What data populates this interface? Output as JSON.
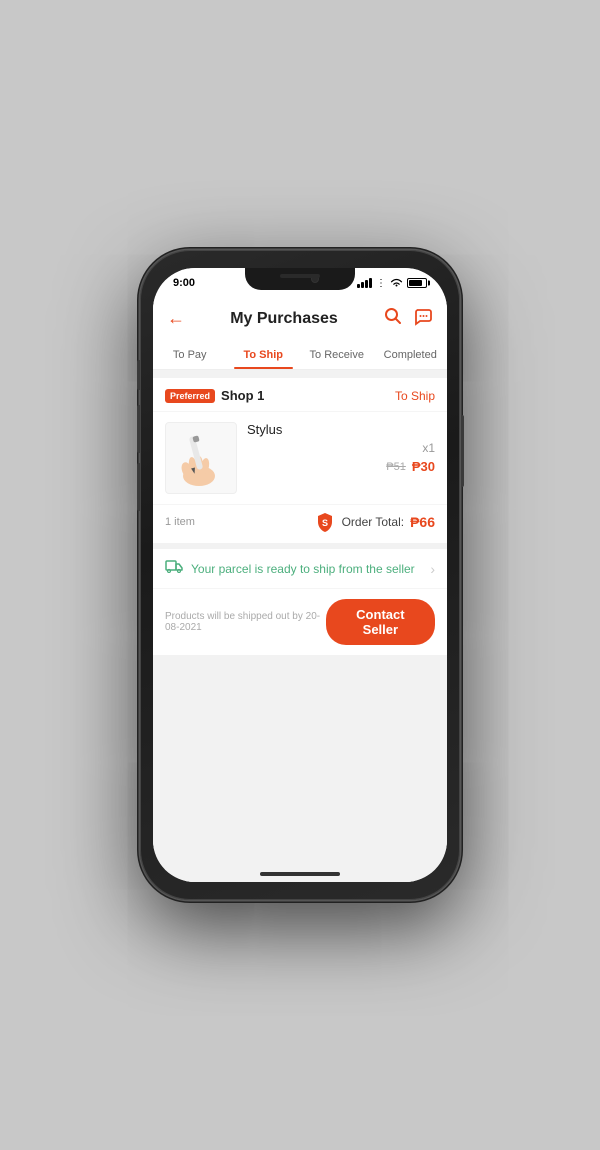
{
  "status_bar": {
    "time": "9:00"
  },
  "header": {
    "title": "My Purchases",
    "back_label": "←",
    "search_icon": "search",
    "chat_icon": "chat"
  },
  "tabs": [
    {
      "id": "to-pay",
      "label": "To Pay",
      "active": false
    },
    {
      "id": "to-ship",
      "label": "To Ship",
      "active": true
    },
    {
      "id": "to-receive",
      "label": "To Receive",
      "active": false
    },
    {
      "id": "completed",
      "label": "Completed",
      "active": false
    }
  ],
  "order": {
    "preferred_badge": "Preferred",
    "shop_name": "Shop 1",
    "shop_status": "To Ship",
    "product": {
      "name": "Stylus",
      "quantity": "x1",
      "price_original": "₱51",
      "price_sale": "₱30"
    },
    "items_count": "1 item",
    "order_total_label": "Order Total:",
    "order_total_amount": "₱66",
    "shipping_message": "Your parcel is ready to ship from the seller",
    "ship_date_text": "Products will be shipped out by 20-08-2021",
    "contact_seller_label": "Contact Seller"
  },
  "colors": {
    "primary": "#e8481e",
    "shipping_green": "#4caf7d"
  }
}
